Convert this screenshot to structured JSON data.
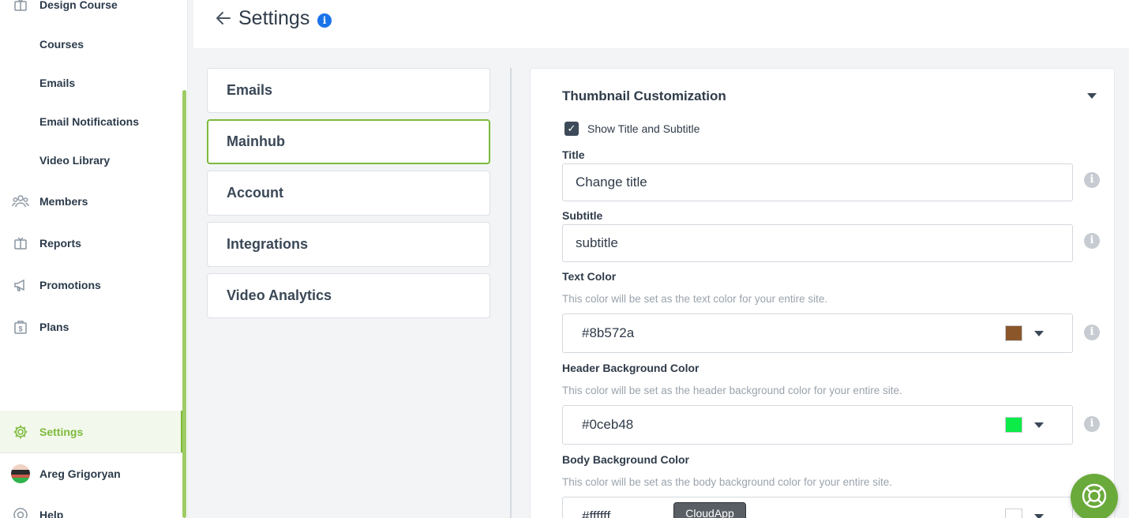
{
  "sidebar": {
    "sections": [
      "Design Course",
      "Members",
      "Reports",
      "Promotions",
      "Plans",
      "Settings",
      "Help"
    ],
    "subitems": [
      "Courses",
      "Emails",
      "Email Notifications",
      "Video Library"
    ],
    "user_name": "Areg Grigoryan",
    "accent_color": "#7cba3b"
  },
  "header": {
    "title": "Settings",
    "info_glyph": "i"
  },
  "categories": [
    "Emails",
    "Mainhub",
    "Account",
    "Integrations",
    "Video Analytics"
  ],
  "active_category": "Mainhub",
  "panel": {
    "section_title": "Thumbnail Customization",
    "show_title_checkbox": {
      "label": "Show Title and Subtitle",
      "checked": true,
      "mark": "✓"
    },
    "title_field": {
      "label": "Title",
      "value": "Change title"
    },
    "subtitle_field": {
      "label": "Subtitle",
      "value": "subtitle"
    },
    "text_color": {
      "label": "Text Color",
      "help": "This color will be set as the text color for your entire site.",
      "value": "#8b572a"
    },
    "header_bg_color": {
      "label": "Header Background Color",
      "help": "This color will be set as the header background color for your entire site.",
      "value": "#0ceb48"
    },
    "body_bg_color": {
      "label": "Body Background Color",
      "help": "This color will be set as the body background color for your entire site.",
      "value": "#ffffff"
    },
    "info_glyph": "i"
  },
  "tooltip": "CloudApp",
  "icons": {
    "back": "arrow-left-icon",
    "help_fab": "lifebuoy-icon"
  }
}
